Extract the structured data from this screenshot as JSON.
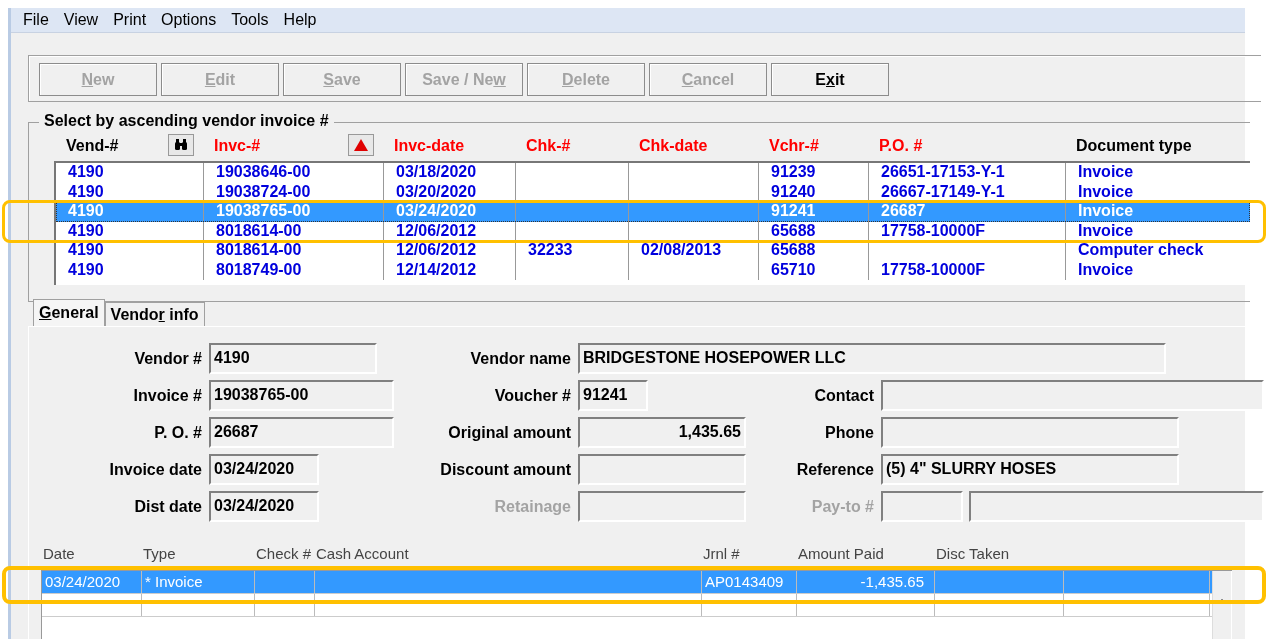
{
  "menu": [
    "File",
    "View",
    "Print",
    "Options",
    "Tools",
    "Help"
  ],
  "toolbar": [
    {
      "key": "N",
      "post": "ew",
      "disabled": true
    },
    {
      "key": "E",
      "post": "dit",
      "disabled": true
    },
    {
      "key": "S",
      "post": "ave",
      "disabled": true
    },
    {
      "pre": "Save / Ne",
      "key": "w",
      "disabled": true
    },
    {
      "key": "D",
      "post": "elete",
      "disabled": true
    },
    {
      "key": "C",
      "post": "ancel",
      "disabled": true
    },
    {
      "pre": "E",
      "key": "x",
      "post": "it",
      "disabled": false
    }
  ],
  "lookup": {
    "title": "Select by ascending vendor invoice #",
    "columns": [
      {
        "label": "Vend-#",
        "color": "#000000",
        "kind": "find"
      },
      {
        "label": "Invc-#",
        "color": "#ff0000",
        "kind": "sort"
      },
      {
        "label": "Invc-date",
        "color": "#ff0000"
      },
      {
        "label": "Chk-#",
        "color": "#ff0000"
      },
      {
        "label": "Chk-date",
        "color": "#ff0000"
      },
      {
        "label": "Vchr-#",
        "color": "#ff0000"
      },
      {
        "label": "P.O. #",
        "color": "#ff0000"
      },
      {
        "label": "Document type",
        "color": "#000000"
      }
    ],
    "rows": [
      {
        "selected": false,
        "cells": [
          "4190",
          "19038646-00",
          "03/18/2020",
          null,
          null,
          "91239",
          "26651-17153-Y-1",
          "Invoice"
        ]
      },
      {
        "selected": false,
        "cells": [
          "4190",
          "19038724-00",
          "03/20/2020",
          null,
          null,
          "91240",
          "26667-17149-Y-1",
          "Invoice"
        ]
      },
      {
        "selected": true,
        "cells": [
          "4190",
          "19038765-00",
          "03/24/2020",
          null,
          null,
          "91241",
          "26687",
          "Invoice"
        ]
      },
      {
        "selected": false,
        "cells": [
          "4190",
          "8018614-00",
          "12/06/2012",
          null,
          null,
          "65688",
          "17758-10000F",
          "Invoice"
        ]
      },
      {
        "selected": false,
        "cells": [
          "4190",
          "8018614-00",
          "12/06/2012",
          "32233",
          "02/08/2013",
          "65688",
          null,
          "Computer check"
        ]
      },
      {
        "selected": false,
        "cells": [
          "4190",
          "8018749-00",
          "12/14/2012",
          null,
          null,
          "65710",
          "17758-10000F",
          "Invoice"
        ]
      }
    ]
  },
  "tabs": [
    {
      "key": "G",
      "post": "eneral",
      "selected": true
    },
    {
      "pre": "Vendo",
      "key": "r",
      "post": " info",
      "selected": false
    }
  ],
  "form": [
    [
      {
        "label": "Vendor #",
        "value": "4190",
        "disabled": false
      },
      {
        "label": "Vendor name",
        "value": "BRIDGESTONE HOSEPOWER LLC",
        "disabled": false
      }
    ],
    [
      {
        "label": "Invoice #",
        "value": "19038765-00",
        "disabled": false
      },
      {
        "label": "Voucher #",
        "value": "91241",
        "disabled": false
      },
      {
        "label": "Contact",
        "disabled": false
      }
    ],
    [
      {
        "label": "P. O. #",
        "value": "26687",
        "disabled": false
      },
      {
        "label": "Original amount",
        "value": "1,435.65",
        "disabled": false
      },
      {
        "label": "Phone",
        "disabled": false
      }
    ],
    [
      {
        "label": "Invoice date",
        "value": "03/24/2020",
        "disabled": false
      },
      {
        "label": "Discount amount",
        "disabled": false
      },
      {
        "label": "Reference",
        "value": "(5) 4\" SLURRY HOSES",
        "disabled": false
      }
    ],
    [
      {
        "label": "Dist date",
        "value": "03/24/2020",
        "disabled": false
      },
      {
        "label": "Retainage",
        "disabled": true
      },
      {
        "label": "Pay-to #",
        "disabled": true
      }
    ]
  ],
  "distribution": {
    "columns": [
      "Date",
      "Type",
      "Check #",
      "Cash Account",
      "Jrnl #",
      "Amount Paid",
      "Disc Taken"
    ],
    "rows": [
      {
        "selected": true,
        "cells": [
          "03/24/2020",
          "* Invoice",
          null,
          null,
          "AP0143409",
          "-1,435.65",
          null
        ]
      }
    ]
  }
}
